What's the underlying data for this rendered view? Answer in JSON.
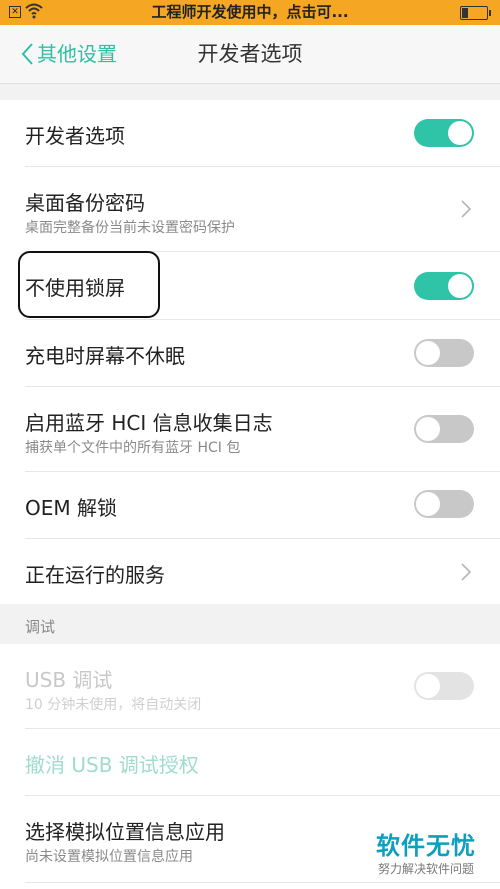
{
  "status_bar": {
    "notice": "工程师开发使用中，点击可..."
  },
  "header": {
    "back_label": "其他设置",
    "title": "开发者选项"
  },
  "rows": [
    {
      "title": "开发者选项",
      "toggle": "on"
    },
    {
      "title": "桌面备份密码",
      "subtitle": "桌面完整备份当前未设置密码保护",
      "chevron": true
    },
    {
      "title": "不使用锁屏",
      "toggle": "on"
    },
    {
      "title": "充电时屏幕不休眠",
      "toggle": "off"
    },
    {
      "title": "启用蓝牙 HCI 信息收集日志",
      "subtitle": "捕获单个文件中的所有蓝牙 HCI 包",
      "toggle": "off"
    },
    {
      "title": "OEM 解锁",
      "toggle": "off"
    },
    {
      "title": "正在运行的服务",
      "chevron": true
    }
  ],
  "debug_section": {
    "header": "调试",
    "rows": [
      {
        "title": "USB 调试",
        "subtitle": "10 分钟未使用，将自动关闭",
        "toggle": "disabled"
      },
      {
        "title": "撤消 USB 调试授权"
      },
      {
        "title": "选择模拟位置信息应用",
        "subtitle": "尚未设置模拟位置信息应用"
      }
    ]
  },
  "watermark": {
    "main": "软件无忧",
    "sub": "努力解决软件问题"
  },
  "colors": {
    "status_bar": "#f5a623",
    "accent": "#2fc4a8",
    "toggle_off": "#c8c8c8"
  }
}
